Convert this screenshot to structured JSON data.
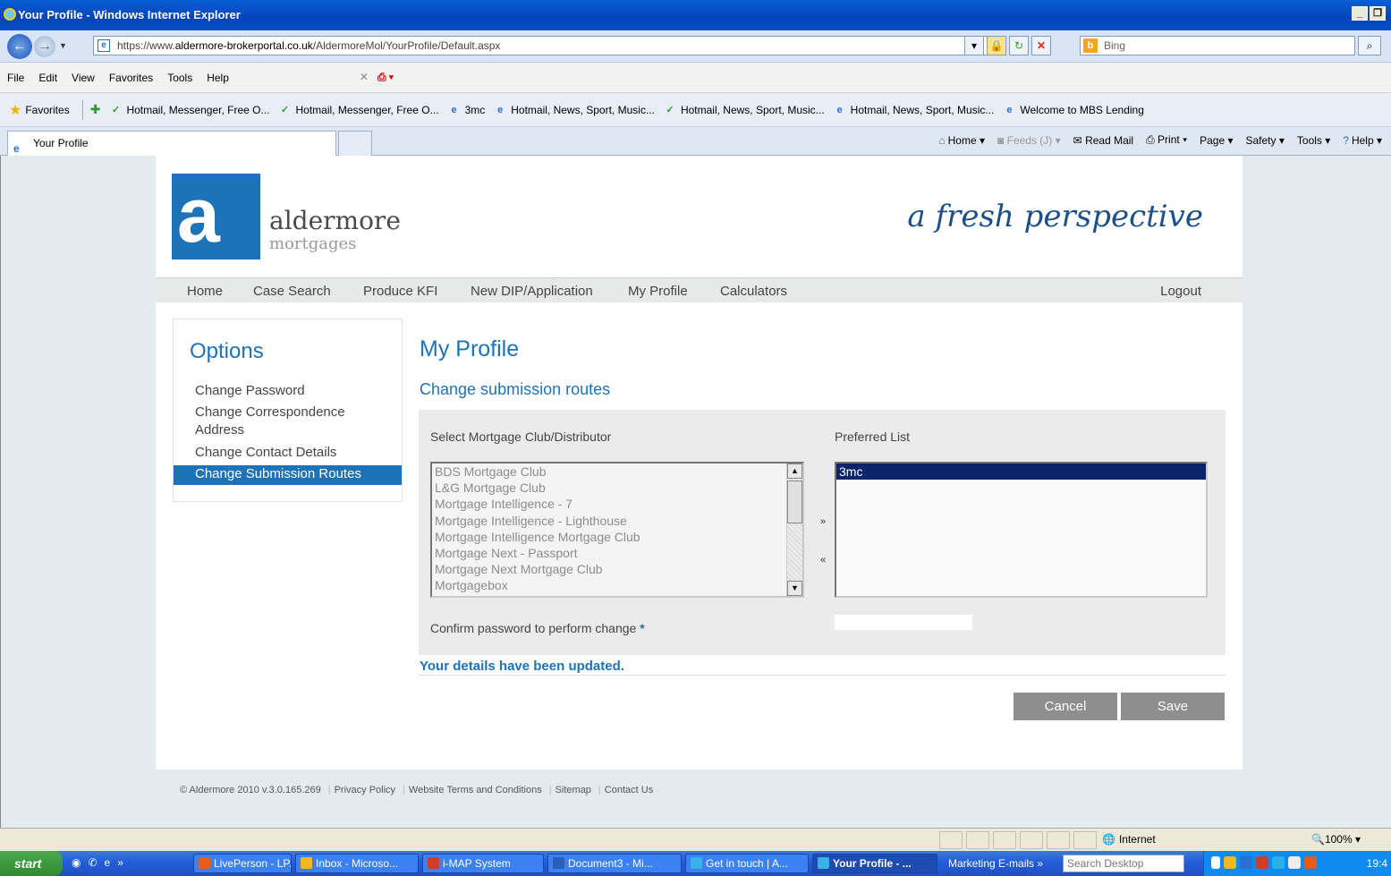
{
  "browser": {
    "window_title": "Your Profile - Windows Internet Explorer",
    "url_prefix": "https://www.",
    "url_domain": "aldermore-brokerportal.co.uk",
    "url_path": "/AldermoreMol/YourProfile/Default.aspx",
    "search_engine": "Bing",
    "menu": [
      "File",
      "Edit",
      "View",
      "Favorites",
      "Tools",
      "Help"
    ],
    "favorites_label": "Favorites",
    "favorites": [
      {
        "label": "Hotmail, Messenger, Free O...",
        "icon": "msn-icon"
      },
      {
        "label": "Hotmail, Messenger, Free O...",
        "icon": "msn-icon"
      },
      {
        "label": "3mc",
        "icon": "ie-page-icon"
      },
      {
        "label": "Hotmail, News, Sport, Music...",
        "icon": "ie-page-icon"
      },
      {
        "label": "Hotmail, News, Sport, Music...",
        "icon": "msn-icon"
      },
      {
        "label": "Hotmail, News, Sport, Music...",
        "icon": "ie-page-icon"
      },
      {
        "label": "Welcome to MBS Lending",
        "icon": "ie-page-icon"
      }
    ],
    "tab_title": "Your Profile",
    "commands": {
      "home": "Home",
      "feeds": "Feeds (J)",
      "read_mail": "Read Mail",
      "print": "Print",
      "page": "Page",
      "safety": "Safety",
      "tools": "Tools",
      "help": "Help"
    },
    "status_zone": "Internet",
    "zoom": "100%"
  },
  "site": {
    "brand_name": "aldermore",
    "brand_sub": "mortgages",
    "tagline": "a fresh perspective",
    "nav": [
      "Home",
      "Case Search",
      "Produce KFI",
      "New DIP/Application",
      "My Profile",
      "Calculators"
    ],
    "logout": "Logout",
    "options_title": "Options",
    "options": [
      "Change Password",
      "Change Correspondence Address",
      "Change Contact Details",
      "Change Submission Routes"
    ],
    "page_title": "My Profile",
    "section_title": "Change submission routes",
    "select_label": "Select Mortgage Club/Distributor",
    "preferred_label": "Preferred List",
    "clubs": [
      "BDS Mortgage Club",
      "L&G Mortgage Club",
      "Mortgage Intelligence - 7",
      "Mortgage Intelligence - Lighthouse",
      "Mortgage Intelligence Mortgage Club",
      "Mortgage Next - Passport",
      "Mortgage Next Mortgage Club",
      "Mortgagebox"
    ],
    "preferred": [
      "3mc"
    ],
    "add_btn": "»",
    "remove_btn": "«",
    "confirm_label": "Confirm password to perform change",
    "required_mark": "*",
    "success_msg": "Your details have been updated.",
    "cancel": "Cancel",
    "save": "Save",
    "footer": {
      "copyright": "© Aldermore 2010  v.3.0.165.269",
      "links": [
        "Privacy Policy",
        "Website Terms and Conditions",
        "Sitemap",
        "Contact Us"
      ]
    }
  },
  "taskbar": {
    "start": "start",
    "items": [
      {
        "label": "LivePerson - LP...",
        "color": "#e85c1a"
      },
      {
        "label": "Inbox - Microso...",
        "color": "#f1b820"
      },
      {
        "label": "i-MAP System",
        "color": "#d23b2a"
      },
      {
        "label": "Document3 - Mi...",
        "color": "#2b5eb8"
      },
      {
        "label": "Get in touch | A...",
        "color": "#3ab0e8"
      },
      {
        "label": "Your Profile - ...",
        "color": "#3ab0e8"
      }
    ],
    "marketing": "Marketing E-mails",
    "search_placeholder": "Search Desktop",
    "clock": "19:4"
  },
  "colors": {
    "brand_blue": "#1e73b8",
    "button_grey": "#8e8e8e",
    "panel_grey": "#ebebeb"
  }
}
